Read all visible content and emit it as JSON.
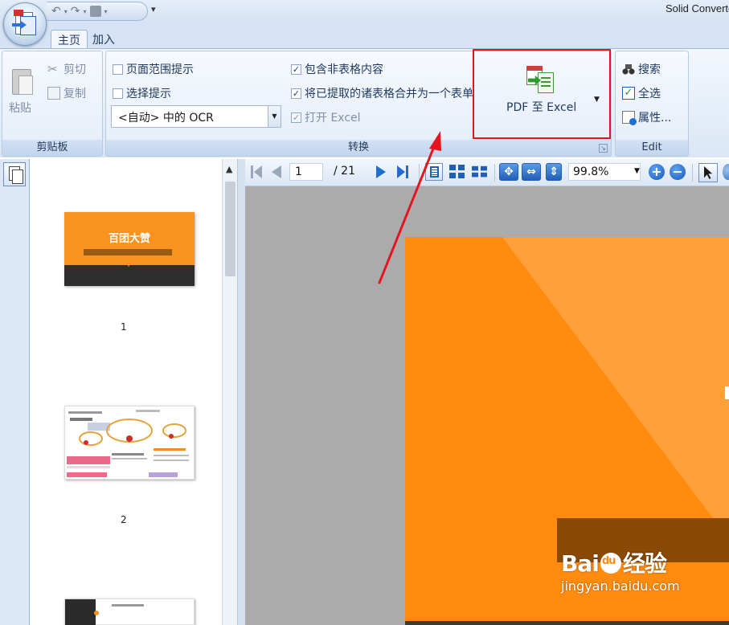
{
  "window": {
    "title": "Solid Converter",
    "qat_more": "▾"
  },
  "tabs": [
    {
      "label": "主页",
      "active": true
    },
    {
      "label": "加入",
      "active": false
    }
  ],
  "ribbon": {
    "clipboard": {
      "label": "剪贴板",
      "paste": "粘贴",
      "cut": "剪切",
      "copy": "复制"
    },
    "convert": {
      "label": "转换",
      "options": [
        {
          "label": "页面范围提示",
          "checked": false
        },
        {
          "label": "选择提示",
          "checked": false
        },
        {
          "label": "包含非表格内容",
          "checked": true
        },
        {
          "label": "将已提取的诸表格合并为一个表单",
          "checked": true
        },
        {
          "label": "打开 Excel",
          "checked": true,
          "disabled": true
        }
      ],
      "ocr_select": "<自动> 中的 OCR",
      "main_button": "PDF 至 Excel"
    },
    "edit": {
      "label": "Edit",
      "search": "搜索",
      "select_all": "全选",
      "properties": "属性..."
    }
  },
  "thumbnails": [
    {
      "page": "1",
      "title": "百团大赞"
    },
    {
      "page": "2"
    },
    {
      "page": ""
    }
  ],
  "viewer": {
    "current_page": "1",
    "total_pages": "/ 21",
    "zoom": "99.8%"
  },
  "colors": {
    "accent": "#1f5fb5",
    "highlight": "#e4151f",
    "slide_orange": "#ff8c0f"
  },
  "watermark": {
    "logo_left": "Bai",
    "logo_right": "经验",
    "url": "jingyan.baidu.com"
  }
}
